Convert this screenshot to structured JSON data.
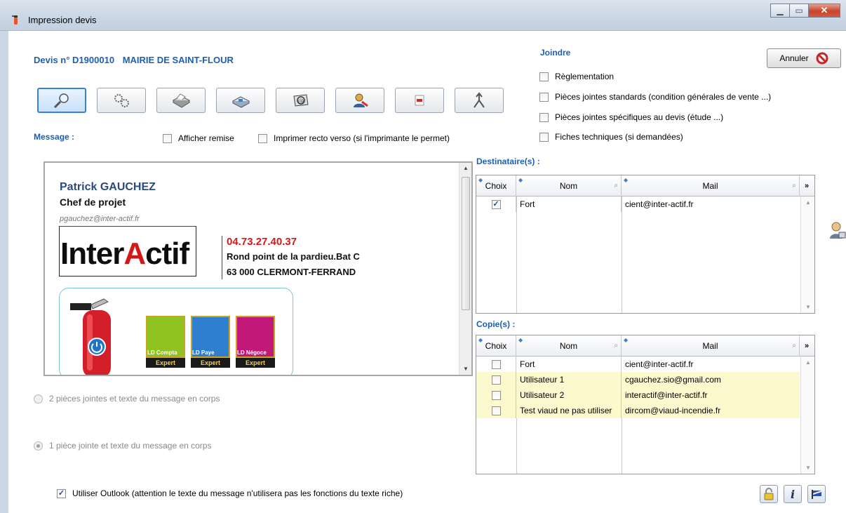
{
  "window": {
    "title": "Impression devis"
  },
  "devis": {
    "number_label": "Devis n° D1900010",
    "client": "MAIRIE DE SAINT-FLOUR"
  },
  "toolbar": {
    "buttons": [
      "preview-icon",
      "settings-gears-icon",
      "printer-icon",
      "fax-icon",
      "email-at-icon",
      "user-icon",
      "pdf-icon",
      "split-arrow-icon"
    ]
  },
  "message": {
    "label": "Message :",
    "afficher_remise": "Afficher remise",
    "recto_verso": "Imprimer recto verso (si l'imprimante le permet)",
    "signature": {
      "name": "Patrick GAUCHEZ",
      "role": "Chef de projet",
      "mail": "pgauchez@inter-actif.fr",
      "logo_a": "Inter",
      "logo_b": "A",
      "logo_c": "ctif",
      "phone": "04.73.27.40.37",
      "address1": "Rond point de la pardieu.Bat C",
      "address2": "63 000 CLERMONT-FERRAND",
      "tiles": [
        {
          "name": "LD Compta",
          "label": "Expert",
          "color": "#8fc31f"
        },
        {
          "name": "LD Paye",
          "label": "Expert",
          "color": "#2f7fd0"
        },
        {
          "name": "LD Négoce",
          "label": "Expert",
          "color": "#c2187a"
        }
      ]
    }
  },
  "options": {
    "radio_1": "2 pièces jointes et texte du message en corps",
    "radio_2": "1 pièce jointe et texte du message en corps",
    "outlook": "Utiliser Outlook (attention le texte du message n'utilisera pas les fonctions du texte riche)"
  },
  "joindre": {
    "title": "Joindre",
    "items": [
      "Règlementation",
      "Pièces jointes standards (condition générales de vente ...)",
      "Pièces jointes spécifiques au devis (étude ...)",
      "Fiches techniques (si demandées)"
    ]
  },
  "annuler": "Annuler",
  "destinataires": {
    "title": "Destinataire(s) :",
    "headers": {
      "choix": "Choix",
      "nom": "Nom",
      "mail": "Mail",
      "more": "»"
    },
    "rows": [
      {
        "checked": true,
        "nom": "Fort",
        "mail": "cient@inter-actif.fr"
      }
    ]
  },
  "copies": {
    "title": "Copie(s) :",
    "headers": {
      "choix": "Choix",
      "nom": "Nom",
      "mail": "Mail",
      "more": "»"
    },
    "rows": [
      {
        "checked": false,
        "nom": "Fort",
        "mail": "cient@inter-actif.fr"
      },
      {
        "checked": false,
        "nom": "Utilisateur 1",
        "mail": "cgauchez.sio@gmail.com"
      },
      {
        "checked": false,
        "nom": "Utilisateur 2",
        "mail": "interactif@inter-actif.fr"
      },
      {
        "checked": false,
        "nom": "Test viaud ne pas utiliser",
        "mail": "dircom@viaud-incendie.fr"
      }
    ]
  },
  "colors": {
    "accent": "#1d5fb0",
    "highlight_row": "#fdf9cf",
    "logo_red": "#d21818"
  }
}
